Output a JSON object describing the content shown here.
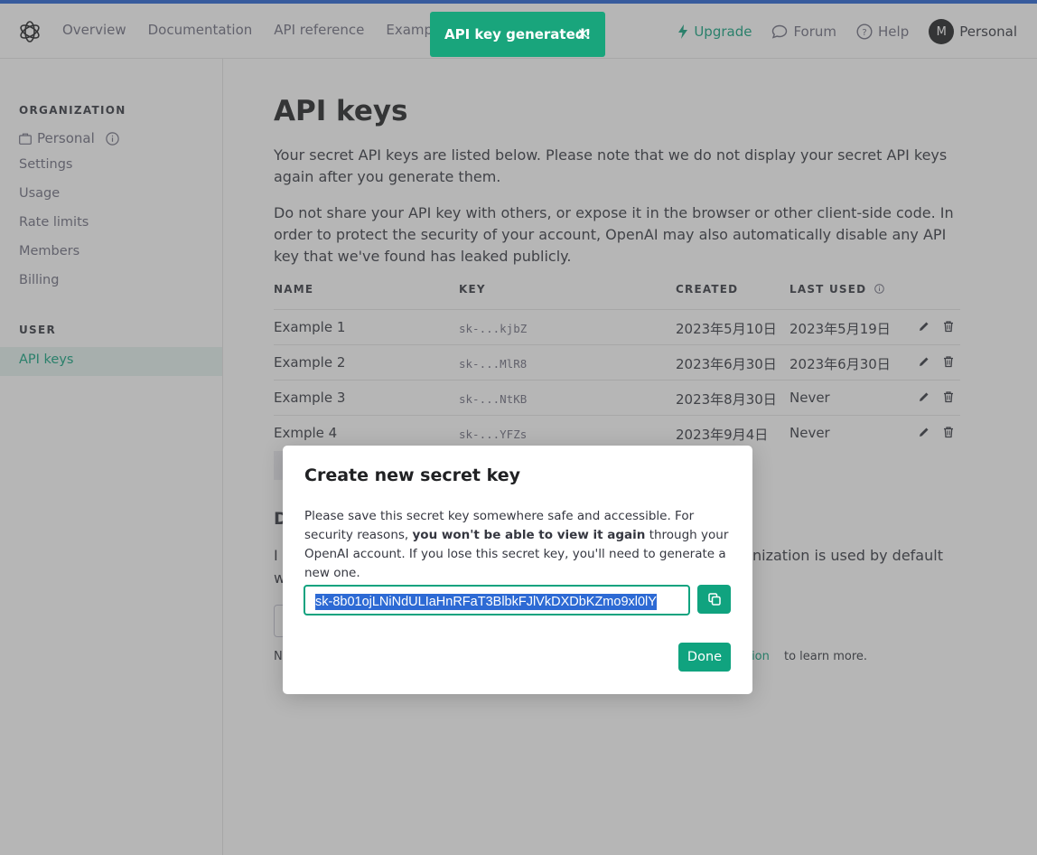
{
  "nav": {
    "links": [
      "Overview",
      "Documentation",
      "API reference",
      "Examples"
    ],
    "upgrade": "Upgrade",
    "forum": "Forum",
    "help": "Help",
    "avatar_initial": "M",
    "account": "Personal"
  },
  "sidebar": {
    "org_heading": "ORGANIZATION",
    "org_name": "Personal",
    "items": [
      "Settings",
      "Usage",
      "Rate limits",
      "Members",
      "Billing"
    ],
    "user_heading": "USER",
    "active_item": "API keys"
  },
  "main": {
    "title": "API keys",
    "intro": "Your secret API keys are listed below. Please note that we do not display your secret API keys again after you generate them.",
    "warning": "Do not share your API key with others, or expose it in the browser or other client-side code. In order to protect the security of your account, OpenAI may also automatically disable any API key that we've found has leaked publicly.",
    "table": {
      "headers": [
        "NAME",
        "KEY",
        "CREATED",
        "LAST USED"
      ],
      "rows": [
        {
          "name": "Example 1",
          "key": "sk-...kjbZ",
          "created": "2023年5月10日",
          "last_used": "2023年5月19日"
        },
        {
          "name": "Example 2",
          "key": "sk-...MlR8",
          "created": "2023年6月30日",
          "last_used": "2023年6月30日"
        },
        {
          "name": "Example 3",
          "key": "sk-...NtKB",
          "created": "2023年8月30日",
          "last_used": "Never"
        },
        {
          "name": "Exmple 4",
          "key": "sk-...YFZs",
          "created": "2023年9月4日",
          "last_used": "Never"
        }
      ]
    },
    "behind_fragments": {
      "d": "D",
      "i": "I",
      "w": "w",
      "n": "N",
      "org_default": "nization is used by default",
      "learn_more_link": "ation",
      "learn_more": " to learn more."
    }
  },
  "toast": {
    "message": "API key generated!",
    "close": "×"
  },
  "modal": {
    "title": "Create new secret key",
    "desc_part1": "Please save this secret key somewhere safe and accessible. For security reasons, ",
    "desc_bold": "you won't be able to view it again",
    "desc_part2": " through your OpenAI account. If you lose this secret key, you'll need to generate a new one.",
    "secret_key": "sk-8b01ojLNiNdULIaHnRFaT3BlbkFJlVkDXDbKZmo9xl0lY",
    "done": "Done"
  },
  "colors": {
    "accent": "#10a37f",
    "top_bar": "#2563d4",
    "toast": "#19a57c",
    "selection": "#2d6ad4"
  }
}
